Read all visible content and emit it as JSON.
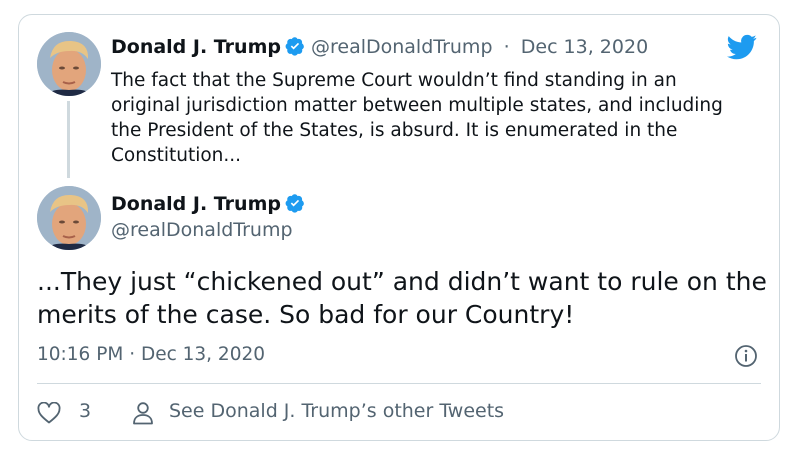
{
  "thread": {
    "first_tweet": {
      "author_name": "Donald J. Trump",
      "handle": "@realDonaldTrump",
      "separator": "·",
      "date": "Dec 13, 2020",
      "text": "The fact that the Supreme Court wouldn’t find standing in an original jurisdiction matter between multiple states, and including the President of the States, is absurd. It is enumerated in the Constitution..."
    },
    "main_tweet": {
      "author_name": "Donald J. Trump",
      "handle": "@realDonaldTrump",
      "text": "...They just “chickened out” and didn’t want to rule on the merits of the case. So bad for our Country!",
      "timestamp": "10:16 PM · Dec 13, 2020"
    }
  },
  "actions": {
    "like_count": "3",
    "see_other_label": "See Donald J. Trump’s other Tweets"
  },
  "icons": {
    "brand": "twitter-bird-icon",
    "verified": "verified-badge-icon",
    "info": "info-icon",
    "like": "heart-icon",
    "profile": "person-icon"
  },
  "colors": {
    "twitter_blue": "#1d9bf0",
    "text": "#0f1419",
    "secondary_text": "#536471",
    "border": "#cfd9de"
  }
}
